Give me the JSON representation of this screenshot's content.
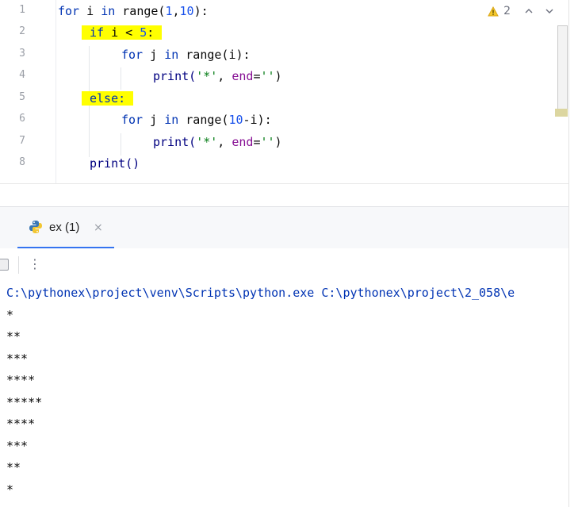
{
  "editor": {
    "line_numbers": [
      "1",
      "2",
      "3",
      "4",
      "5",
      "6",
      "7",
      "8"
    ],
    "lines": [
      {
        "t1": "for",
        "t2": " i ",
        "t3": "in",
        "t4": " range(",
        "t5": "1",
        "t6": ",",
        "t7": "10",
        "t8": "):"
      },
      {
        "t1": "if",
        "t2": " i < ",
        "t3": "5",
        "t4": ":"
      },
      {
        "t1": "for",
        "t2": " j ",
        "t3": "in",
        "t4": " range(i):"
      },
      {
        "t1": "print(",
        "t2": "'*'",
        "t3": ", ",
        "t4": "end",
        "t5": "=",
        "t6": "''",
        "t7": ")"
      },
      {
        "t1": "else:"
      },
      {
        "t1": "for",
        "t2": " j ",
        "t3": "in",
        "t4": " range(",
        "t5": "10",
        "t6": "-i):"
      },
      {
        "t1": "print(",
        "t2": "'*'",
        "t3": ", ",
        "t4": "end",
        "t5": "=",
        "t6": "''",
        "t7": ")"
      },
      {
        "t1": "print()"
      }
    ],
    "inspection": {
      "warning_count": "2",
      "icon": "warning-icon",
      "prev_icon": "chevron-up-icon",
      "next_icon": "chevron-down-icon"
    },
    "highlight_color": "#ffff00"
  },
  "run_panel": {
    "tab_label": "ex (1)",
    "tab_icon": "python-icon",
    "close_glyph": "×",
    "more_glyph": "⋮"
  },
  "console": {
    "command": "C:\\pythonex\\project\\venv\\Scripts\\python.exe C:\\pythonex\\project\\2_058\\e",
    "output": [
      "*",
      "**",
      "***",
      "****",
      "*****",
      "****",
      "***",
      "**",
      "*"
    ]
  }
}
